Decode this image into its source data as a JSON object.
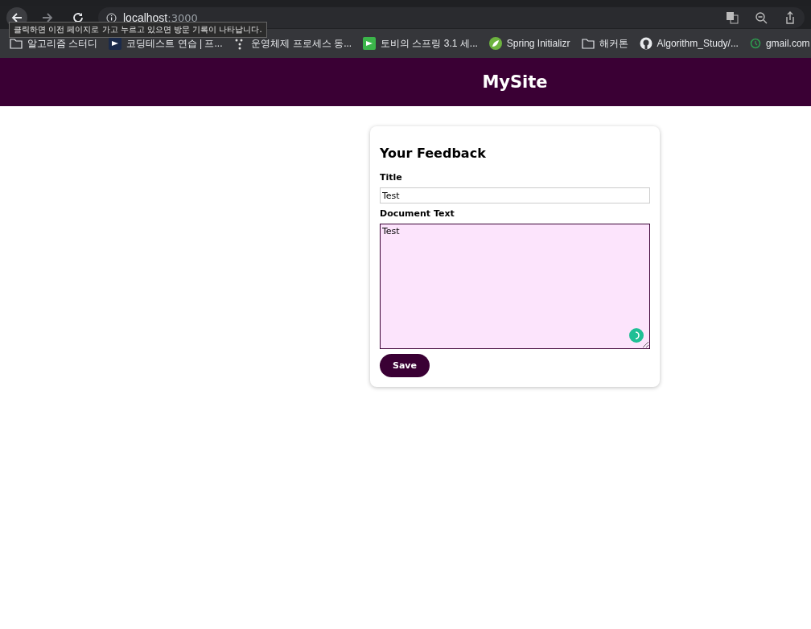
{
  "browser": {
    "address": {
      "host": "localhost",
      "port": ":3000"
    },
    "tooltip": "클릭하면 이전 페이지로 가고 누르고 있으면 방문 기록이 나타납니다.",
    "bookmarks": [
      {
        "kind": "folder",
        "label": "알고리즘 스터디"
      },
      {
        "kind": "site",
        "label": "코딩테스트 연습 | 프...",
        "color": "#1b2a4a"
      },
      {
        "kind": "dots",
        "label": "운영체제 프로세스 동..."
      },
      {
        "kind": "site",
        "label": "토비의 스프링 3.1 세...",
        "color": "#3bb54a"
      },
      {
        "kind": "leaf",
        "label": "Spring Initializr",
        "color": "#6db33f"
      },
      {
        "kind": "folder",
        "label": "해커톤"
      },
      {
        "kind": "github",
        "label": "Algorithm_Study/..."
      },
      {
        "kind": "clock",
        "label": "gmail.com",
        "color": "#2e9e4f"
      }
    ]
  },
  "header": {
    "title": "MySite"
  },
  "form": {
    "heading": "Your Feedback",
    "fields": [
      {
        "kind": "input",
        "label": "Title",
        "value": "Test",
        "focused": false
      },
      {
        "kind": "textarea",
        "label": "Document Text",
        "value": "Test",
        "focused": true
      }
    ],
    "button": "Save"
  }
}
